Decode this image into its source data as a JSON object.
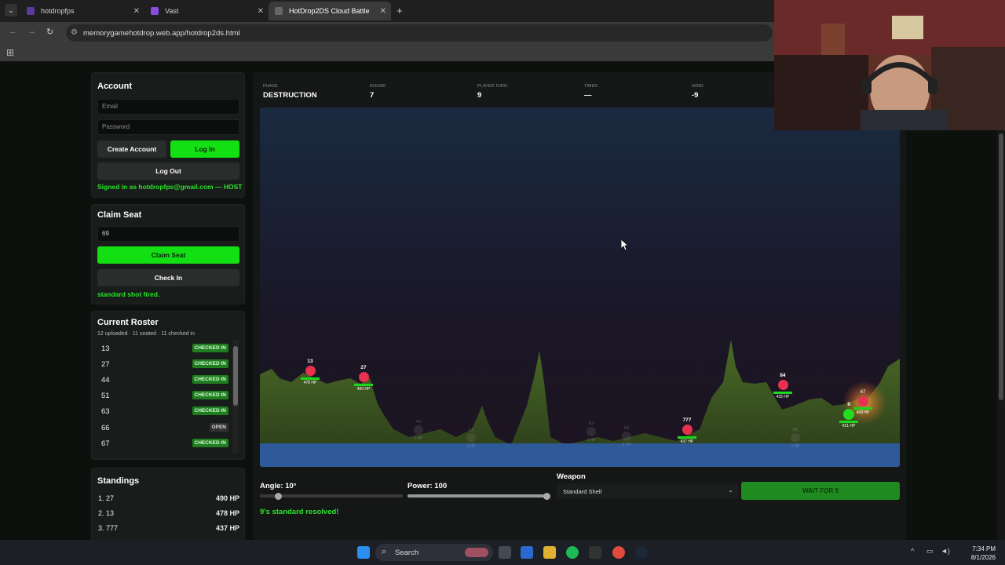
{
  "browser": {
    "tabs": [
      {
        "title": "hotdropfps",
        "fav_color": "#5a3aa0"
      },
      {
        "title": "Vast",
        "fav_color": "#8a4be0"
      },
      {
        "title": "HotDrop2DS Cloud Battle",
        "fav_color": "#555555"
      }
    ],
    "url": "memorygamehotdrop.web.app/hotdrop2ds.html"
  },
  "account": {
    "title": "Account",
    "email_placeholder": "Email",
    "password_placeholder": "Password",
    "create_label": "Create Account",
    "login_label": "Log In",
    "logout_label": "Log Out",
    "status": "Signed in as hotdropfps@gmail.com — HOST"
  },
  "seat": {
    "title": "Claim Seat",
    "seat_value": "69",
    "claim_label": "Claim Seat",
    "checkin_label": "Check In",
    "status": "standard shot fired."
  },
  "roster": {
    "title": "Current Roster",
    "summary": "12 uploaded · 11 seated · 11 checked in",
    "rows": [
      {
        "num": "13",
        "status": "CHECKED IN"
      },
      {
        "num": "27",
        "status": "CHECKED IN"
      },
      {
        "num": "44",
        "status": "CHECKED IN"
      },
      {
        "num": "51",
        "status": "CHECKED IN"
      },
      {
        "num": "63",
        "status": "CHECKED IN"
      },
      {
        "num": "66",
        "status": "OPEN"
      },
      {
        "num": "67",
        "status": "CHECKED IN"
      }
    ]
  },
  "standings": {
    "title": "Standings",
    "rows": [
      {
        "rank": "1. 27",
        "hp": "490 HP"
      },
      {
        "rank": "2. 13",
        "hp": "478 HP"
      },
      {
        "rank": "3. 777",
        "hp": "437 HP"
      }
    ]
  },
  "hud": {
    "phase_label": "PHASE",
    "phase": "DESTRUCTION",
    "round_label": "ROUND",
    "round": "7",
    "turn_label": "PLAYER TURN",
    "turn": "9",
    "timer_label": "TIMER",
    "timer": "—",
    "wind_label": "WIND",
    "wind": "-9"
  },
  "players": [
    {
      "id": "13",
      "hp": "478 HP",
      "alive": true
    },
    {
      "id": "27",
      "hp": "490 HP",
      "alive": true
    },
    {
      "id": "44",
      "hp": "0 HP",
      "alive": false
    },
    {
      "id": "51",
      "hp": "0 HP",
      "alive": false
    },
    {
      "id": "63",
      "hp": "0 HP",
      "alive": false
    },
    {
      "id": "69",
      "hp": "0 HP",
      "alive": false
    },
    {
      "id": "777",
      "hp": "437 HP",
      "alive": true
    },
    {
      "id": "84",
      "hp": "435 HP",
      "alive": true
    },
    {
      "id": "86",
      "hp": "0 HP",
      "alive": false
    },
    {
      "id": "9",
      "hp": "431 HP",
      "alive": true,
      "current": true
    },
    {
      "id": "67",
      "hp": "408 HP",
      "alive": true
    }
  ],
  "controls": {
    "angle_label": "Angle: 10°",
    "angle": 10,
    "power_label": "Power: 100",
    "power": 100,
    "weapon_label": "Weapon",
    "weapon_value": "Standard Shell",
    "wait_label": "WAIT FOR 9",
    "status": "9's standard resolved!"
  },
  "taskbar": {
    "search": "Search",
    "time": "7:34 PM",
    "date": "8/1/2026"
  }
}
